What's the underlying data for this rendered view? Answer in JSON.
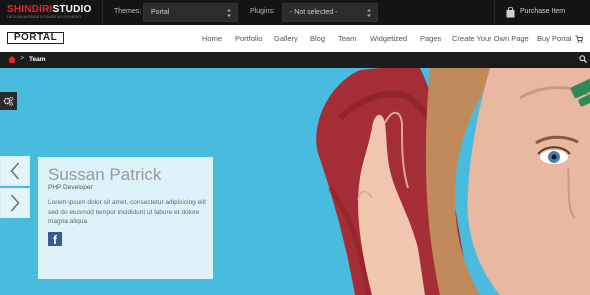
{
  "demo_bar": {
    "brand_red": "SHINDIRI",
    "brand_white": "STUDIO",
    "brand_tagline": "DESIGN/WEB/DESIGN/DEVELOPMENT",
    "themes_label": "Themes:",
    "themes_value": "Portal",
    "plugins_label": "Plugins:",
    "plugins_value": "- Not selected -",
    "purchase_label": "Purchase Item",
    "purchase_icon": "shopping-bag-icon"
  },
  "header": {
    "logo_text": "PORTAL",
    "nav": [
      "Home",
      "Portfolio",
      "Gallery",
      "Blog",
      "Team",
      "Widgetized",
      "Pages",
      "Create Your Own Page",
      "Buy Portal"
    ],
    "buy_icon": "cart-icon"
  },
  "breadcrumb": {
    "home_icon": "home-icon",
    "separator": ">",
    "current": "Team",
    "search_icon": "search-icon"
  },
  "hero": {
    "settings_icon": "gears-icon",
    "prev_icon": "chevron-left-icon",
    "next_icon": "chevron-right-icon",
    "member_name": "Sussan Patrick",
    "member_role": "PHP Developer",
    "member_bio": "Lorem ipsum dolor sit amet, consectetur adipisicing elit sed do eiusmod tempor incididunt ut labore et dolore magna aliqua.",
    "facebook_icon": "facebook-icon",
    "colors": {
      "background": "#48bcdf",
      "hood": "#a52d36",
      "skin": "#e8b8a0",
      "hair": "#c08a5a"
    }
  }
}
